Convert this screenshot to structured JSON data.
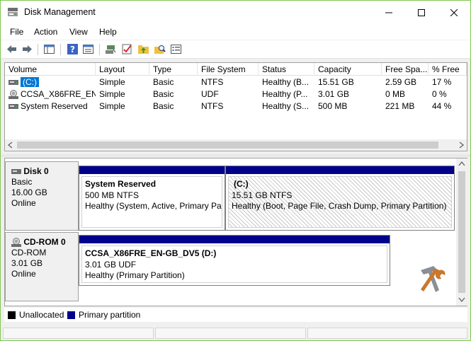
{
  "window": {
    "title": "Disk Management"
  },
  "menu": [
    "File",
    "Action",
    "View",
    "Help"
  ],
  "toolbar_icons": [
    "back-icon",
    "forward-icon",
    "show-hide-console-tree-icon",
    "help-icon",
    "properties-icon",
    "connect-icon",
    "check-icon",
    "folder-up-icon",
    "search-folder-icon",
    "details-icon"
  ],
  "list": {
    "columns": [
      "Volume",
      "Layout",
      "Type",
      "File System",
      "Status",
      "Capacity",
      "Free Spa...",
      "% Free"
    ],
    "rows": [
      {
        "volume": "(C:)",
        "layout": "Simple",
        "type": "Basic",
        "fs": "NTFS",
        "status": "Healthy (B...",
        "capacity": "15.51 GB",
        "free": "2.59 GB",
        "pct": "17 %",
        "icon": "drive-icon",
        "selected": true
      },
      {
        "volume": "CCSA_X86FRE_EN-...",
        "layout": "Simple",
        "type": "Basic",
        "fs": "UDF",
        "status": "Healthy (P...",
        "capacity": "3.01 GB",
        "free": "0 MB",
        "pct": "0 %",
        "icon": "cdrom-icon",
        "selected": false
      },
      {
        "volume": "System Reserved",
        "layout": "Simple",
        "type": "Basic",
        "fs": "NTFS",
        "status": "Healthy (S...",
        "capacity": "500 MB",
        "free": "221 MB",
        "pct": "44 %",
        "icon": "drive-icon",
        "selected": false
      }
    ]
  },
  "disks": [
    {
      "name": "Disk 0",
      "type": "Basic",
      "size": "16.00 GB",
      "state": "Online",
      "partitions": [
        {
          "name": "System Reserved",
          "size": "500 MB NTFS",
          "status": "Healthy (System, Active, Primary Par",
          "selected": false
        },
        {
          "name": "(C:)",
          "size": "15.51 GB NTFS",
          "status": "Healthy (Boot, Page File, Crash Dump, Primary Partition)",
          "selected": true
        }
      ]
    },
    {
      "name": "CD-ROM 0",
      "type": "CD-ROM",
      "size": "3.01 GB",
      "state": "Online",
      "partitions": [
        {
          "name": "CCSA_X86FRE_EN-GB_DV5 (D:)",
          "size": "3.01 GB UDF",
          "status": "Healthy (Primary Partition)",
          "selected": false
        }
      ]
    }
  ],
  "legend": [
    {
      "label": "Unallocated",
      "color": "#000000"
    },
    {
      "label": "Primary partition",
      "color": "#00008b"
    }
  ],
  "colors": {
    "accent": "#0078d7",
    "primary_partition": "#00008b",
    "window_border": "#7ec850"
  }
}
